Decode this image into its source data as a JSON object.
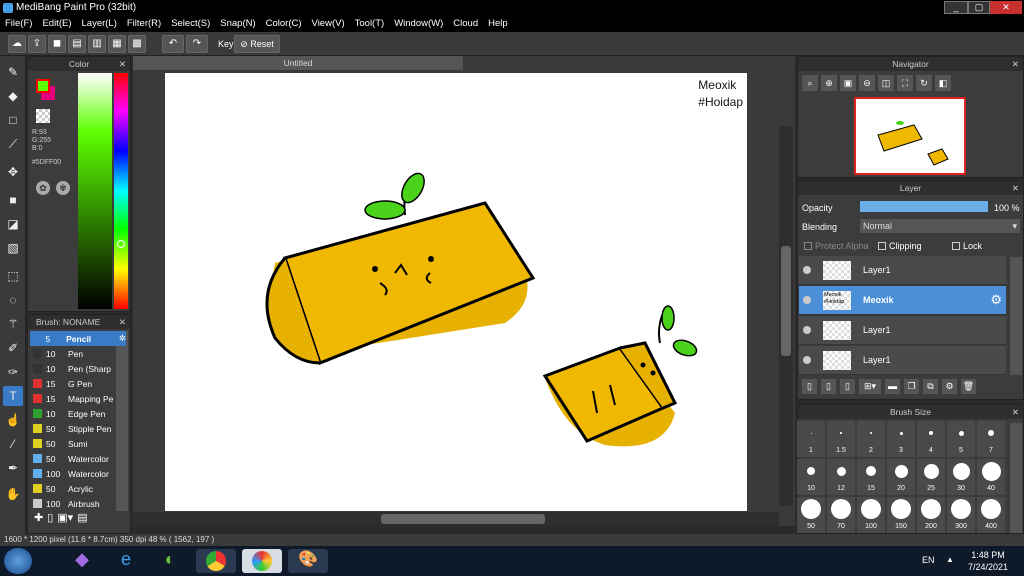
{
  "window": {
    "title": "MediBang Paint Pro (32bit)",
    "min": "_",
    "max": "▢",
    "close": "✕"
  },
  "menu": [
    "File(F)",
    "Edit(E)",
    "Layer(L)",
    "Filter(R)",
    "Select(S)",
    "Snap(N)",
    "Color(C)",
    "View(V)",
    "Tool(T)",
    "Window(W)",
    "Cloud",
    "Help"
  ],
  "toolbar": {
    "key_label": "Key",
    "reset_label": "Reset"
  },
  "color_panel": {
    "title": "Color",
    "r": "R:93",
    "g": "G:255",
    "b": "B:0",
    "hex": "#5DFF00",
    "primary": "#5DFF00",
    "secondary": "#E6007E"
  },
  "brush_panel": {
    "title": "Brush: NONAME",
    "items": [
      {
        "size": "5",
        "name": "Pencil",
        "color": "#3a7bc8"
      },
      {
        "size": "10",
        "name": "Pen",
        "color": "#333333"
      },
      {
        "size": "10",
        "name": "Pen (Sharp",
        "color": "#333333"
      },
      {
        "size": "15",
        "name": "G Pen",
        "color": "#e03030"
      },
      {
        "size": "15",
        "name": "Mapping Pe",
        "color": "#e03030"
      },
      {
        "size": "10",
        "name": "Edge Pen",
        "color": "#30a030"
      },
      {
        "size": "50",
        "name": "Stipple Pen",
        "color": "#e0d020"
      },
      {
        "size": "50",
        "name": "Sumi",
        "color": "#e0d020"
      },
      {
        "size": "50",
        "name": "Watercolor",
        "color": "#60b0f0"
      },
      {
        "size": "100",
        "name": "Watercolor",
        "color": "#60b0f0"
      },
      {
        "size": "50",
        "name": "Acrylic",
        "color": "#e0d020"
      },
      {
        "size": "100",
        "name": "Airbrush",
        "color": "#cccccc"
      }
    ]
  },
  "document": {
    "tab_title": "Untitled",
    "caption_1": "Meoxik",
    "caption_2": "#Hoidap"
  },
  "navigator": {
    "title": "Navigator"
  },
  "layer_panel": {
    "title": "Layer",
    "opacity_label": "Opacity",
    "opacity_value": "100 %",
    "opacity_fraction": 1.0,
    "blending_label": "Blending",
    "blending_value": "Normal",
    "protect_alpha": "Protect Alpha",
    "clipping": "Clipping",
    "lock": "Lock",
    "layers": [
      {
        "name": "Layer1",
        "selected": false
      },
      {
        "name": "Meoxik",
        "selected": true,
        "thumb_text": "Meoxik #Hoidap"
      },
      {
        "name": "Layer1",
        "selected": false
      },
      {
        "name": "Layer1",
        "selected": false
      }
    ]
  },
  "brush_size_panel": {
    "title": "Brush Size",
    "sizes": [
      "1",
      "1.5",
      "2",
      "3",
      "4",
      "5",
      "7",
      "10",
      "12",
      "15",
      "20",
      "25",
      "30",
      "40",
      "50",
      "70",
      "100",
      "150",
      "200",
      "300",
      "400"
    ]
  },
  "status": {
    "text": "1600 * 1200 pixel  (11.6 * 8.7cm)  350 dpi  48 %  ( 1562, 197 )"
  },
  "taskbar": {
    "lang": "EN",
    "time": "1:48 PM",
    "date": "7/24/2021"
  }
}
